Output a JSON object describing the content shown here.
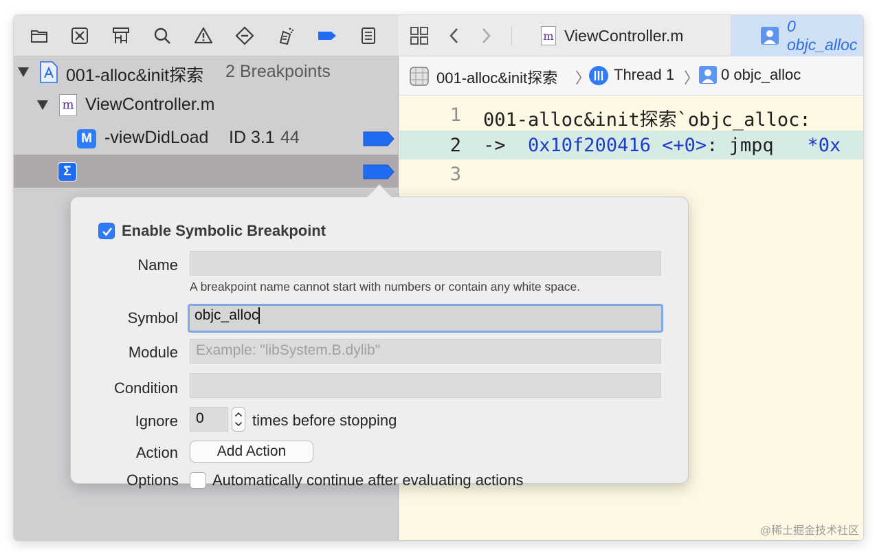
{
  "navigator": {
    "toolbar_icons": [
      "folder-icon",
      "source-control-icon",
      "symbol-icon",
      "search-icon",
      "issue-warning-icon",
      "test-icon",
      "debug-icon",
      "breakpoint-icon",
      "report-icon"
    ],
    "project": {
      "name": "001-alloc&init探索",
      "count": "2 Breakpoints"
    },
    "file": {
      "name": "ViewController.m",
      "icon_letter": "m"
    },
    "method_breakpoint": {
      "badge": "M",
      "name": "-viewDidLoad",
      "id": "ID 3.1",
      "line": "44"
    },
    "symbolic_breakpoint": {
      "badge": "Σ"
    }
  },
  "editor": {
    "tabs": [
      "ViewController.m",
      "0 objc_alloc"
    ],
    "breadcrumbs": [
      "001-alloc&init探索",
      "Thread 1",
      "0 objc_alloc"
    ],
    "lines": [
      {
        "num": "1",
        "text": "001-alloc&init探索`objc_alloc:"
      },
      {
        "num": "2",
        "prefix": "->  ",
        "addr": "0x10f200416",
        "offset": " <+0>",
        "instr": ": jmpq   ",
        "tail": "*0x"
      },
      {
        "num": "3",
        "text": ""
      }
    ]
  },
  "popover": {
    "enable_label": "Enable Symbolic Breakpoint",
    "enable_checked": true,
    "name_label": "Name",
    "name_value": "",
    "name_help": "A breakpoint name cannot start with numbers or contain any white space.",
    "symbol_label": "Symbol",
    "symbol_value": "objc_alloc",
    "module_label": "Module",
    "module_placeholder": "Example: \"libSystem.B.dylib\"",
    "condition_label": "Condition",
    "ignore_label": "Ignore",
    "ignore_value": "0",
    "ignore_suffix": "times before stopping",
    "action_label": "Action",
    "add_action_button": "Add Action",
    "options_label": "Options",
    "options_text": "Automatically continue after evaluating actions",
    "options_checked": false
  },
  "watermark": "@稀土掘金技术社区",
  "colors": {
    "accent": "#2e7cf6",
    "navigator_bg": "#cfced1",
    "editor_bg": "#fdf8e4",
    "pc_line": "#d6ebe4"
  }
}
